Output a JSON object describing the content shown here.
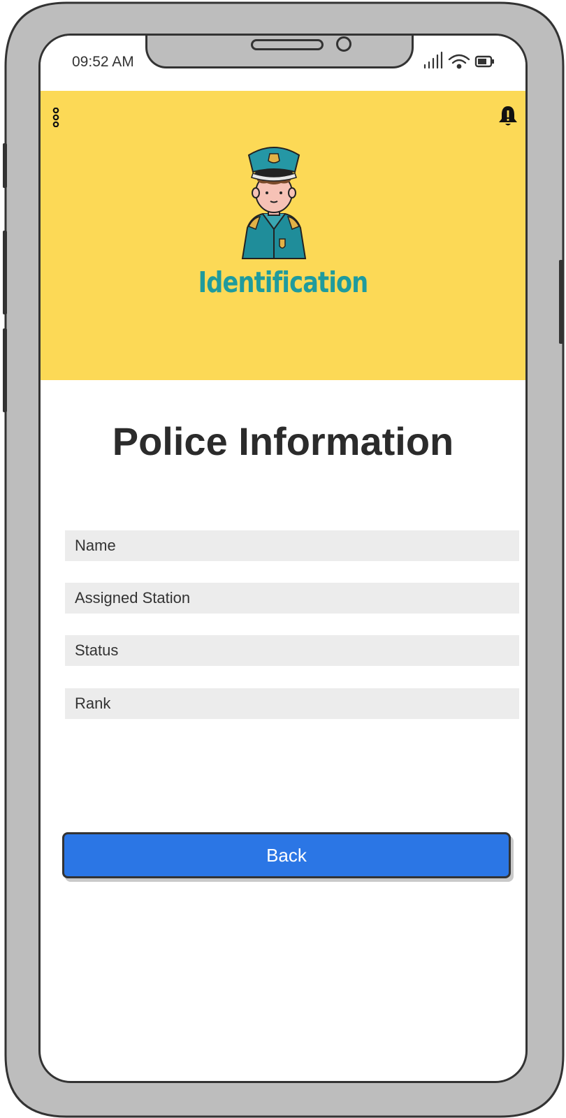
{
  "status_bar": {
    "time": "09:52 AM",
    "icons": [
      "signal-icon",
      "wifi-icon",
      "battery-icon"
    ]
  },
  "header": {
    "menu_icon": "more-vertical-icon",
    "notification_icon": "bell-alert-icon",
    "logo_text": "Identification",
    "background_color": "#fcd956",
    "logo_text_color": "#1f9b9d"
  },
  "main": {
    "title": "Police Information",
    "fields": [
      {
        "placeholder": "Name"
      },
      {
        "placeholder": "Assigned Station"
      },
      {
        "placeholder": "Status"
      },
      {
        "placeholder": "Rank"
      }
    ],
    "back_button": "Back",
    "button_color": "#2b76e5"
  }
}
